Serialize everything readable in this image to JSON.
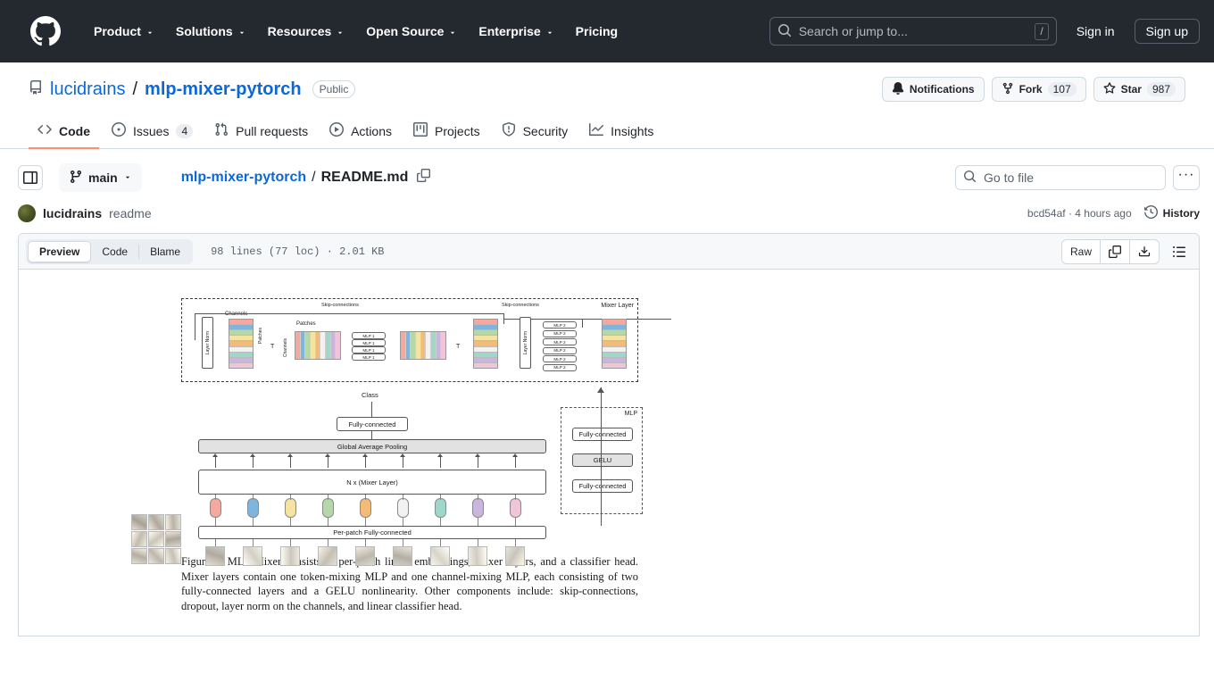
{
  "header": {
    "logo_name": "github-logo",
    "nav": [
      {
        "label": "Product",
        "caret": true
      },
      {
        "label": "Solutions",
        "caret": true
      },
      {
        "label": "Resources",
        "caret": true
      },
      {
        "label": "Open Source",
        "caret": true
      },
      {
        "label": "Enterprise",
        "caret": true
      },
      {
        "label": "Pricing",
        "caret": false
      }
    ],
    "search": {
      "placeholder": "Search or jump to...",
      "shortcut": "/"
    },
    "sign_in": "Sign in",
    "sign_up": "Sign up",
    "bg_color": "#24292f"
  },
  "repo": {
    "owner": "lucidrains",
    "separator": "/",
    "name": "mlp-mixer-pytorch",
    "visibility": "Public",
    "actions": {
      "notifications": "Notifications",
      "fork_label": "Fork",
      "fork_count": "107",
      "star_label": "Star",
      "star_count": "987"
    },
    "tabs": [
      {
        "label": "Code",
        "count": "",
        "active": true
      },
      {
        "label": "Issues",
        "count": "4",
        "active": false
      },
      {
        "label": "Pull requests",
        "count": "",
        "active": false
      },
      {
        "label": "Actions",
        "count": "",
        "active": false
      },
      {
        "label": "Projects",
        "count": "",
        "active": false
      },
      {
        "label": "Security",
        "count": "",
        "active": false
      },
      {
        "label": "Insights",
        "count": "",
        "active": false
      }
    ],
    "active_tab_underline_color": "#fd8c73"
  },
  "file_nav": {
    "branch": "main",
    "breadcrumb_repo": "mlp-mixer-pytorch",
    "breadcrumb_sep": "/",
    "breadcrumb_file": "README.md",
    "go_to_file_placeholder": "Go to file",
    "more_options": "···"
  },
  "commit": {
    "author": "lucidrains",
    "message": "readme",
    "sha": "bcd54af",
    "time": "· 4 hours ago",
    "history": "History"
  },
  "file_toolbar": {
    "views": [
      {
        "label": "Preview",
        "active": true
      },
      {
        "label": "Code",
        "active": false
      },
      {
        "label": "Blame",
        "active": false
      }
    ],
    "meta": "98 lines (77 loc) · 2.01 KB",
    "raw": "Raw",
    "copy_icon": "copy-icon",
    "download_icon": "download-icon",
    "toc_icon": "outline-icon"
  },
  "figure": {
    "mixer_layer_label": "Mixer Layer",
    "skip_left": "Skip-connections",
    "skip_right": "Skip-connections",
    "channels_label": "Channels",
    "patches_label_vert": "Patches",
    "patches_label": "Patches",
    "channels_label_vert": "Channels",
    "layer_norm": "Layer Norm",
    "transpose_symbol": "T",
    "mlp1": "MLP 1",
    "mlp2": "MLP 2",
    "class_label": "Class",
    "fully_connected": "Fully-connected",
    "global_avg_pooling": "Global Average Pooling",
    "n_mixer_layer": "N x (Mixer Layer)",
    "per_patch_fc": "Per-patch Fully-connected",
    "mlp_detail_title": "MLP",
    "gelu": "GELU",
    "caption": "Figure 1: MLP-Mixer consists of per-patch linear embeddings, Mixer layers, and a classifier head. Mixer layers contain one token-mixing MLP and one channel-mixing MLP, each consisting of two fully-connected layers and a GELU nonlinearity. Other components include: skip-connections, dropout, layer norm on the channels, and linear classifier head.",
    "band_colors": [
      "#f4a9a0",
      "#7fb4dd",
      "#b7d7a8",
      "#f4e3a1",
      "#f2bb77",
      "#f2f2f2",
      "#9fd8cb",
      "#c9b6dd",
      "#f2c4d8"
    ],
    "pill_colors": [
      "#f4a9a0",
      "#7fb4dd",
      "#f4e3a1",
      "#b7d7a8",
      "#f2bb77",
      "#f2f2f2",
      "#9fd8cb",
      "#c9b6dd",
      "#f2c4d8"
    ],
    "mlp1_count": 4,
    "mlp2_count": 6
  }
}
